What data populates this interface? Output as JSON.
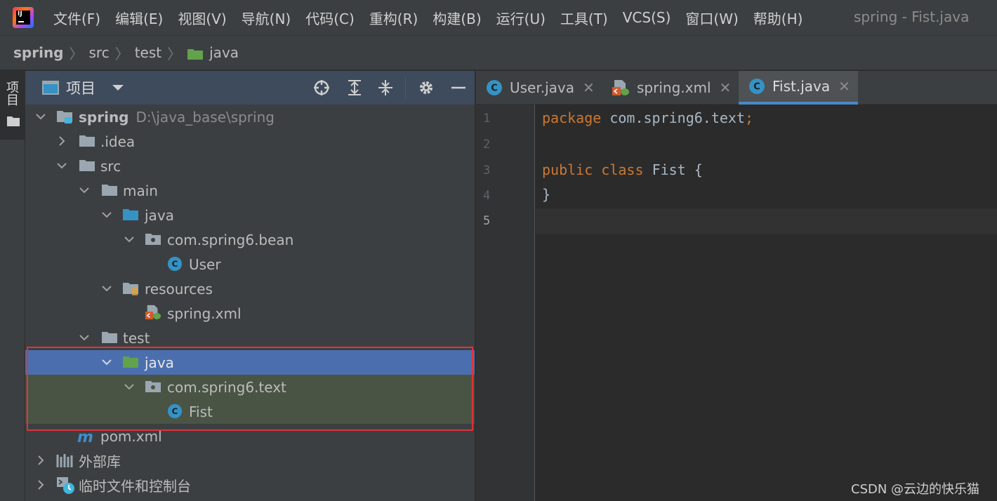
{
  "menubar": {
    "items": [
      "文件(F)",
      "编辑(E)",
      "视图(V)",
      "导航(N)",
      "代码(C)",
      "重构(R)",
      "构建(B)",
      "运行(U)",
      "工具(T)",
      "VCS(S)",
      "窗口(W)",
      "帮助(H)"
    ],
    "window_title": "spring - Fist.java"
  },
  "breadcrumb": [
    "spring",
    "src",
    "test",
    "java"
  ],
  "stripe": {
    "tab_label": "项目"
  },
  "project": {
    "header_title": "项目",
    "tree": [
      {
        "label": "spring",
        "path": "D:\\java_base\\spring",
        "icon": "module-folder-icon",
        "expanded": true
      },
      {
        "label": ".idea",
        "icon": "folder-icon",
        "expanded": false
      },
      {
        "label": "src",
        "icon": "folder-icon",
        "expanded": true
      },
      {
        "label": "main",
        "icon": "folder-icon",
        "expanded": true
      },
      {
        "label": "java",
        "icon": "source-root-folder-icon",
        "expanded": true
      },
      {
        "label": "com.spring6.bean",
        "icon": "package-icon",
        "expanded": true
      },
      {
        "label": "User",
        "icon": "class-icon"
      },
      {
        "label": "resources",
        "icon": "resources-folder-icon",
        "expanded": true
      },
      {
        "label": "spring.xml",
        "icon": "spring-xml-icon"
      },
      {
        "label": "test",
        "icon": "folder-icon",
        "expanded": true
      },
      {
        "label": "java",
        "icon": "test-root-folder-icon",
        "expanded": true,
        "selected": true
      },
      {
        "label": "com.spring6.text",
        "icon": "package-icon",
        "expanded": true
      },
      {
        "label": "Fist",
        "icon": "class-icon"
      },
      {
        "label": "pom.xml",
        "icon": "maven-icon"
      },
      {
        "label": "外部库",
        "icon": "library-icon",
        "expanded": false
      },
      {
        "label": "临时文件和控制台",
        "icon": "scratch-icon",
        "expanded": false
      }
    ]
  },
  "editor": {
    "tabs": [
      {
        "label": "User.java",
        "icon": "class-icon"
      },
      {
        "label": "spring.xml",
        "icon": "spring-xml-icon"
      },
      {
        "label": "Fist.java",
        "icon": "class-icon",
        "active": true
      }
    ],
    "line_numbers": [
      "1",
      "2",
      "3",
      "4",
      "5"
    ],
    "lines": {
      "l1_kw": "package",
      "l1_rest": " com.spring6.text",
      "l1_semi": ";",
      "l3_kw1": "public",
      "l3_kw2": "class",
      "l3_name": "Fist",
      "l3_brace": "{",
      "l4": "}"
    }
  },
  "watermark": "CSDN @云边的快乐猫",
  "colors": {
    "menubar_bg": "#3c3f41",
    "editor_bg": "#2b2b2b",
    "selected_row": "#4b6eaf",
    "highlight_rows": "#4a5445",
    "highlight_box": "#e0333a",
    "keyword": "#cc7832",
    "class_icon": "#3592c4"
  }
}
